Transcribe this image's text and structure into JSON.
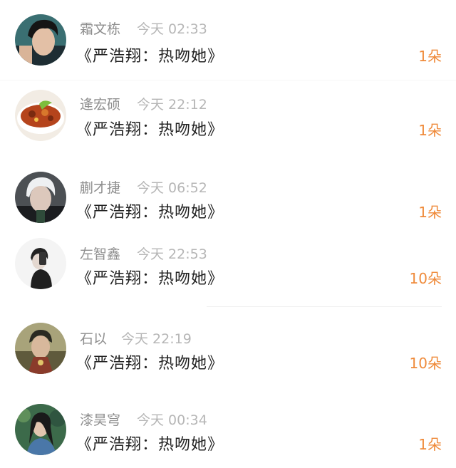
{
  "accent_color": "#ef8a3a",
  "items": [
    {
      "name": "霜文栋",
      "time": "今天 02:33",
      "title": "《严浩翔：热吻她》",
      "count": "1朵",
      "avatar": "male-portrait-avatar"
    },
    {
      "name": "逄宏硕",
      "time": "今天 22:12",
      "title": "《严浩翔：热吻她》",
      "count": "1朵",
      "avatar": "food-bowl-avatar"
    },
    {
      "name": "蒯才捷",
      "time": "今天 06:52",
      "title": "《严浩翔：热吻她》",
      "count": "1朵",
      "avatar": "white-hair-avatar"
    },
    {
      "name": "左智鑫",
      "time": "今天 22:53",
      "title": "《严浩翔：热吻她》",
      "count": "10朵",
      "avatar": "mirror-selfie-avatar"
    },
    {
      "name": "石以",
      "time": "今天 22:19",
      "title": "《严浩翔：热吻她》",
      "count": "10朵",
      "avatar": "costume-portrait-avatar"
    },
    {
      "name": "漆昊穹",
      "time": "今天 00:34",
      "title": "《严浩翔：热吻她》",
      "count": "1朵",
      "avatar": "garden-portrait-avatar"
    }
  ]
}
